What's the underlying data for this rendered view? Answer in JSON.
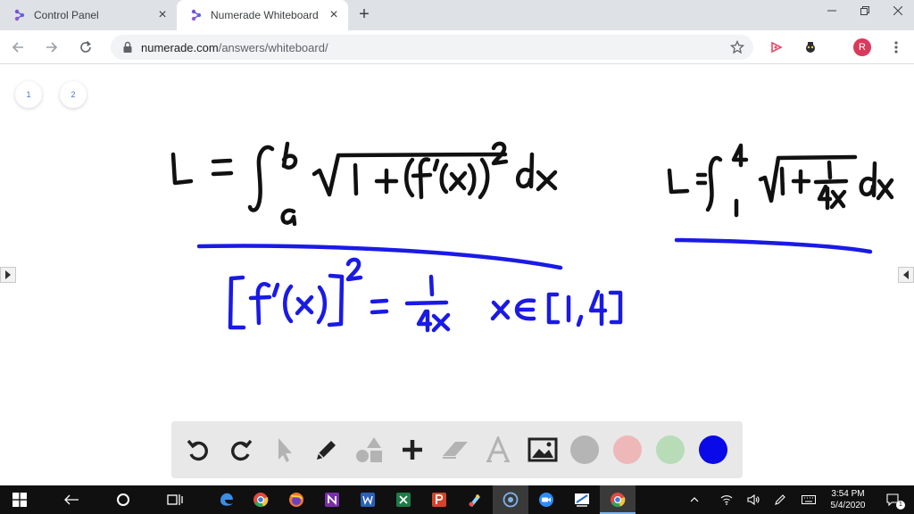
{
  "browser": {
    "tabs": [
      {
        "title": "Control Panel",
        "active": false
      },
      {
        "title": "Numerade Whiteboard",
        "active": true
      }
    ],
    "url_host": "numerade.com",
    "url_path": "/answers/whiteboard/",
    "profile_initial": "R"
  },
  "whiteboard": {
    "pages": [
      "1",
      "2"
    ],
    "ink_color_black": "#111111",
    "ink_color_blue": "#1a1ae6",
    "palette": [
      "#b5b5b5",
      "#efb8b8",
      "#b7dcb7",
      "#0a0ae8"
    ]
  },
  "taskbar": {
    "time": "3:54 PM",
    "date": "5/4/2020",
    "notifications": "1"
  }
}
